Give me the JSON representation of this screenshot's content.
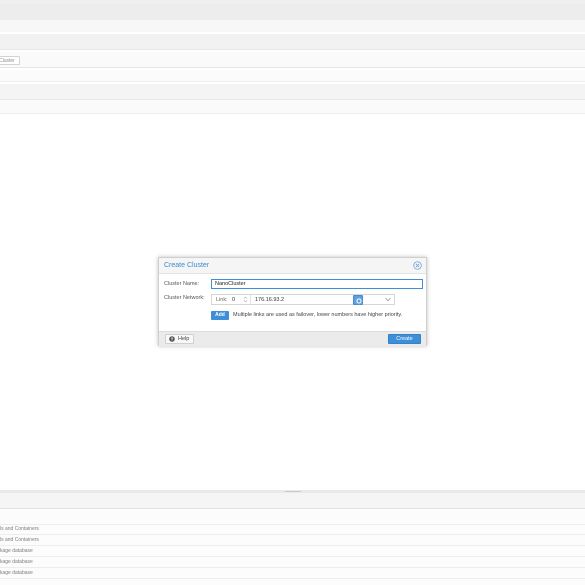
{
  "background": {
    "cluster_chip_label": "Cluster",
    "task_rows": [
      "ls and Containers",
      "ls and Containers",
      "kage database",
      "kage database",
      "kage database"
    ]
  },
  "dialog": {
    "title": "Create Cluster",
    "cluster_name_label": "Cluster Name:",
    "cluster_name_value": "NanoCluster",
    "cluster_network_label": "Cluster Network:",
    "link_label": "Link:",
    "link_number": "0",
    "link_address": "176.16.93.2",
    "add_label": "Add",
    "info_text": "Multiple links are used as failover, lower numbers have higher priority.",
    "help_label": "Help",
    "create_label": "Create"
  },
  "colors": {
    "accent": "#3f8fd8",
    "title": "#3a8ad0"
  },
  "icons": {
    "close": "close-icon",
    "spinner": "spinner-icon",
    "chevron": "chevron-down-icon",
    "settings": "gear-icon",
    "help": "help-icon"
  }
}
